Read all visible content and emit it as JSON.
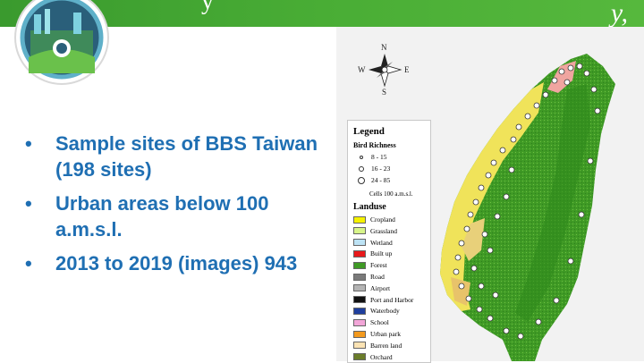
{
  "header": {
    "accent_color": "#49ad35",
    "trailing_glyph": "y,",
    "leading_glyph": "y"
  },
  "logo": {
    "icon": "project-logo-icon"
  },
  "bullets": [
    {
      "text": "Sample sites of BBS Taiwan (198 sites)"
    },
    {
      "text": "Urban areas below 100 a.m.s.l."
    },
    {
      "text": "2013 to 2019 (images) 943"
    }
  ],
  "bullet_marker": "•",
  "compass": {
    "north": "N",
    "south": "S",
    "east": "E",
    "west": "W"
  },
  "legend": {
    "title": "Legend",
    "bird_richness_title": "Bird Richness",
    "richness": [
      {
        "label": "8 - 15"
      },
      {
        "label": "16 - 23"
      },
      {
        "label": "24 - 85"
      }
    ],
    "cells_label": "Cells 100 a.m.s.l.",
    "landuse_title": "Landuse",
    "landuse": [
      {
        "label": "Cropland",
        "color": "#f5f200"
      },
      {
        "label": "Grassland",
        "color": "#d8f58a"
      },
      {
        "label": "Wetland",
        "color": "#bde3f5"
      },
      {
        "label": "Built up",
        "color": "#e8191b"
      },
      {
        "label": "Forest",
        "color": "#3f9a25"
      },
      {
        "label": "Road",
        "color": "#7a7a7a"
      },
      {
        "label": "Airport",
        "color": "#b4b4b4"
      },
      {
        "label": "Port and Harbor",
        "color": "#111111"
      },
      {
        "label": "Waterbody",
        "color": "#1f3f9e"
      },
      {
        "label": "School",
        "color": "#f2a6d8"
      },
      {
        "label": "Urban park",
        "color": "#f39a1e"
      },
      {
        "label": "Barren land",
        "color": "#fbe3b4"
      },
      {
        "label": "Orchard",
        "color": "#6b7d2a"
      }
    ]
  }
}
